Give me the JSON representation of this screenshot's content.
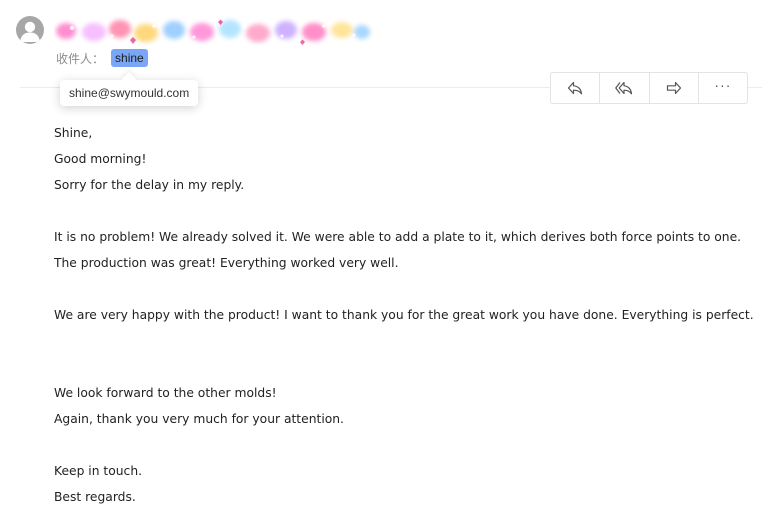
{
  "header": {
    "recipient_label": "收件人：",
    "recipient_name": "shine",
    "recipient_tooltip": "shine@swymould.com"
  },
  "toolbar": {
    "icons": [
      "reply-icon",
      "reply-all-icon",
      "forward-icon",
      "more-icon"
    ],
    "more_label": "···"
  },
  "body": {
    "lines": [
      "Shine,",
      "Good morning!",
      "Sorry for the delay in my reply.",
      "",
      "It is no problem! We already solved it. We were able to add a plate to it, which derives both force points to one.",
      "The production was great! Everything worked very well.",
      "",
      "We are very happy with the product! I want to thank you for the great work you have done. Everything is perfect.",
      "",
      "",
      "We look forward to the other molds!",
      "Again, thank you very much for your attention.",
      "",
      "Keep in touch.",
      "Best regards."
    ]
  },
  "colors": {
    "chip_bg": "#7aa7f5",
    "avatar": "#a7a7a7",
    "text": "#222222",
    "label": "#8a8a8a"
  }
}
